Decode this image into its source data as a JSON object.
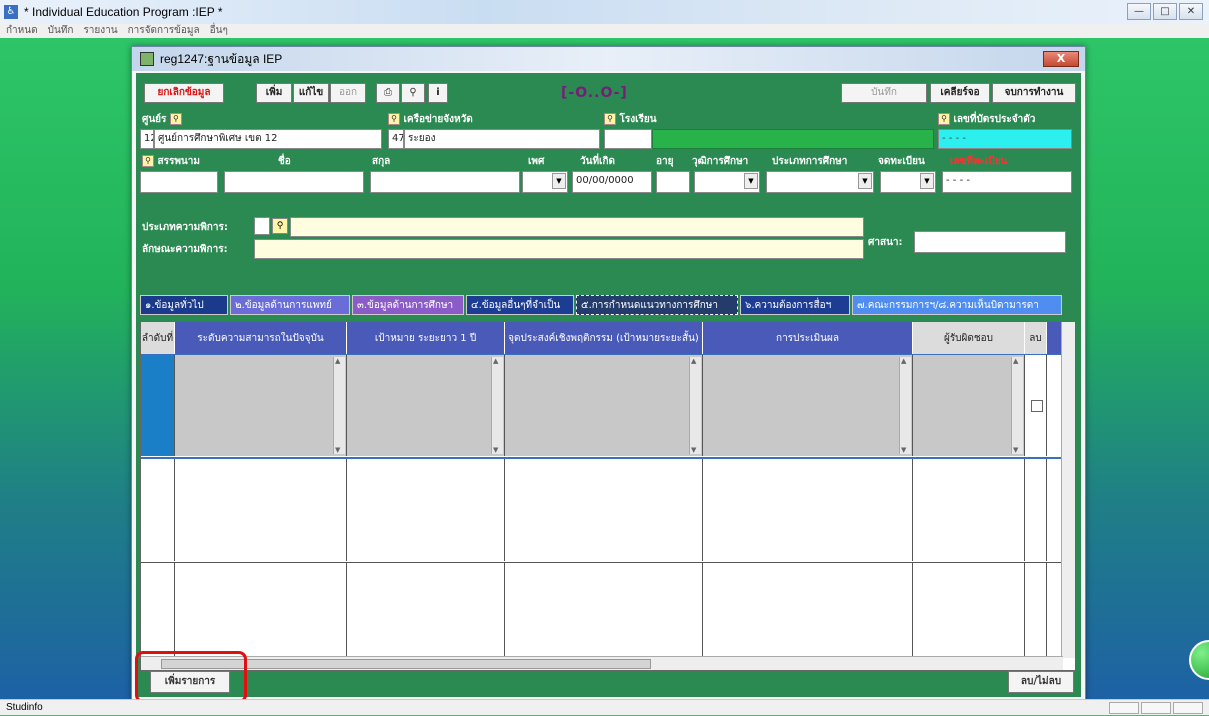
{
  "os": {
    "title": "* Individual Education Program :IEP *",
    "menu": [
      "กำหนด",
      "บันทึก",
      "รายงาน",
      "การจัดการข้อมูล",
      "อื่นๆ"
    ],
    "status": "Studinfo"
  },
  "window": {
    "title": "reg1247:ฐานข้อมูล IEP",
    "close_label": "X"
  },
  "toolbar": {
    "cancel": "ยกเลิกข้อมูล",
    "add": "เพิ่ม",
    "edit": "แก้ไข",
    "exit": "ออก",
    "center": "[-O..O-]",
    "save": "บันทึก",
    "clear": "เคลียร์จอ",
    "finish": "จบการทำงาน"
  },
  "form": {
    "center_label": "ศูนย์ร",
    "network_label": "เครือข่ายจังหวัด",
    "school_label": "โรงเรียน",
    "id_label": "เลขที่บัตรประจำตัว",
    "center_code": "12",
    "center_name": "ศูนย์การศึกษาพิเศษ เขต 12",
    "province_code": "47",
    "province_name": "ระยอง",
    "id_value": "- - - -",
    "surname_label": "สรรพนาม",
    "name_label": "ชื่อ",
    "lastname_label": "สกุล",
    "sex_label": "เพศ",
    "dob_label": "วันที่เกิด",
    "age_label": "อายุ",
    "edu_level_label": "วุฒิการศึกษา",
    "edu_type_label": "ประเภทการศึกษา",
    "reg_label": "จดทะเบียน",
    "reg_no_label": "เลขที่ทะเบียน",
    "dob_value": "00/00/0000",
    "reg_no_value": "- - - -",
    "disability_type_label": "ประเภทความพิการ:",
    "disability_char_label": "ลักษณะความพิการ:",
    "religion_label": "ศาสนา:"
  },
  "tabs": [
    "๑.ข้อมูลทั่วไป",
    "๒.ข้อมูลด้านการแพทย์",
    "๓.ข้อมูลด้านการศึกษา",
    "๔.ข้อมูลอื่นๆที่จำเป็น",
    "๕.การกำหนดแนวทางการศึกษา",
    "๖.ความต้องการสื่อฯ",
    "๗.คณะกรรมการฯ/๘.ความเห็นบิดามารดา"
  ],
  "grid": {
    "headers": {
      "no": "ลำดับที่",
      "current": "ระดับความสามารถในปัจจุบัน",
      "goal": "เป้าหมาย ระยะยาว 1 ปี",
      "objective": "จุดประสงค์เชิงพฤติกรรม (เป้าหมายระยะสั้น)",
      "evaluation": "การประเมินผล",
      "responsible": "ผู้รับผิดชอบ",
      "delete": "ลบ"
    }
  },
  "bottom": {
    "add_item": "เพิ่มรายการ",
    "delete_toggle": "ลบ/ไม่ลบ"
  }
}
